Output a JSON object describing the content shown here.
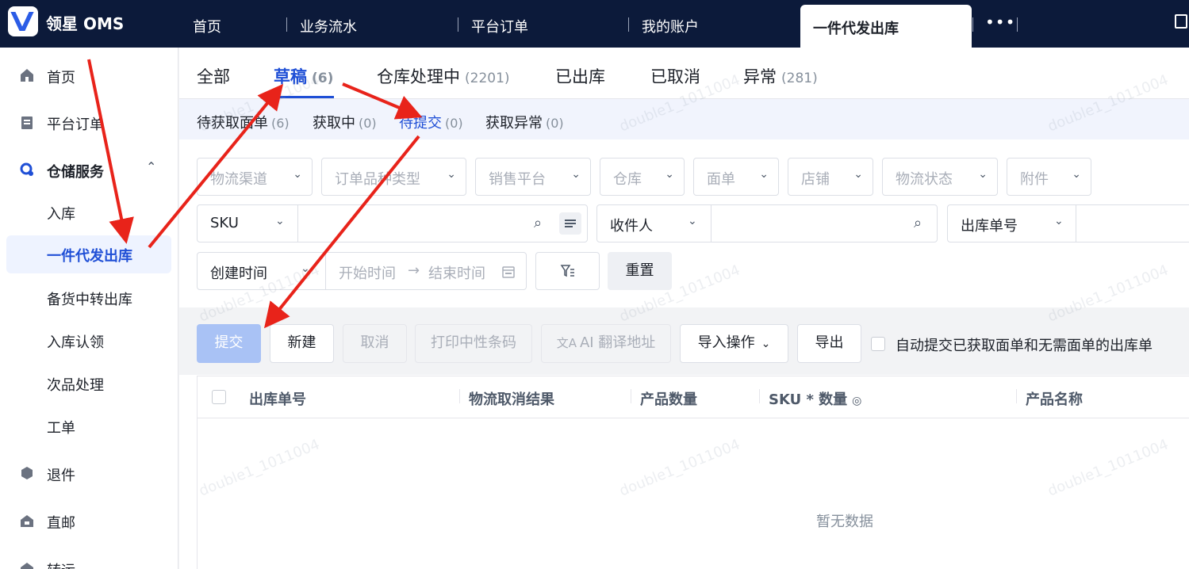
{
  "topbar": {
    "brand": "领星 OMS",
    "tabs": [
      "首页",
      "业务流水",
      "平台订单",
      "我的账户"
    ],
    "active_tab": "一件代发出库",
    "more": "•••"
  },
  "sidebar": {
    "items": [
      {
        "label": "首页",
        "icon": "home-icon"
      },
      {
        "label": "平台订单",
        "icon": "clipboard-icon"
      },
      {
        "label": "仓储服务",
        "icon": "warehouse-icon",
        "expanded": true
      },
      {
        "label": "退件",
        "icon": "return-box-icon"
      },
      {
        "label": "直邮",
        "icon": "direct-mail-icon"
      },
      {
        "label": "转运",
        "icon": "transfer-icon"
      }
    ],
    "sub_items": [
      "入库",
      "一件代发出库",
      "备货中转出库",
      "入库认领",
      "次品处理",
      "工单"
    ],
    "active_sub": "一件代发出库"
  },
  "main": {
    "tabs": [
      {
        "label": "全部",
        "count": ""
      },
      {
        "label": "草稿",
        "count": "(6)"
      },
      {
        "label": "仓库处理中",
        "count": "(2201)"
      },
      {
        "label": "已出库",
        "count": ""
      },
      {
        "label": "已取消",
        "count": ""
      },
      {
        "label": "异常",
        "count": "(281)"
      }
    ],
    "active_tab": "草稿",
    "sub_tabs": [
      {
        "label": "待获取面单",
        "count": "(6)"
      },
      {
        "label": "获取中",
        "count": "(0)"
      },
      {
        "label": "待提交",
        "count": "(0)"
      },
      {
        "label": "获取异常",
        "count": "(0)"
      }
    ],
    "active_sub_tab": "待提交",
    "filters": [
      "物流渠道",
      "订单品种类型",
      "销售平台",
      "仓库",
      "面单",
      "店铺",
      "物流状态",
      "附件"
    ],
    "search": {
      "sku_key": "SKU",
      "receiver_key": "收件人",
      "outbound_key": "出库单号",
      "date_key": "创建时间",
      "start_placeholder": "开始时间",
      "end_placeholder": "结束时间",
      "arrow": "→",
      "reset": "重置"
    },
    "actions": {
      "submit": "提交",
      "create": "新建",
      "cancel": "取消",
      "print_barcode": "打印中性条码",
      "ai_translate": "AI 翻译地址",
      "import": "导入操作",
      "export": "导出",
      "auto_submit_label": "自动提交已获取面单和无需面单的出库单"
    },
    "table": {
      "columns": [
        "出库单号",
        "物流取消结果",
        "产品数量",
        "SKU * 数量",
        "产品名称"
      ],
      "empty_text": "暂无数据"
    },
    "watermark": "double1_1011004"
  },
  "colors": {
    "primary": "#1f4fd6",
    "topbar_bg": "#0c1a3a",
    "arrow": "#e8231a"
  }
}
